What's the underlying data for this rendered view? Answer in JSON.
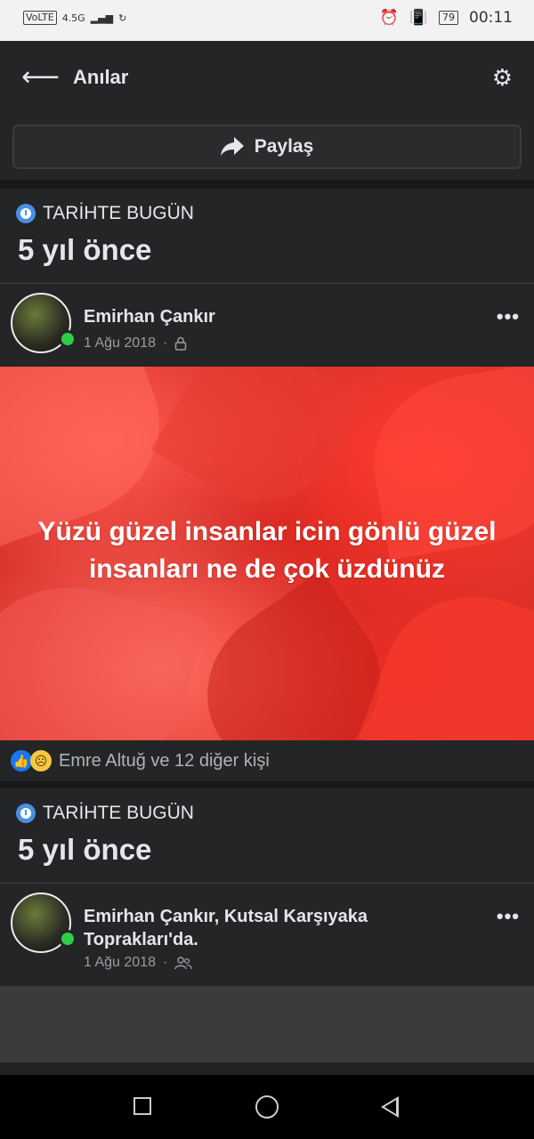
{
  "status": {
    "volte": "VoLTE",
    "network": "4.5G",
    "battery": "79",
    "time": "00:11"
  },
  "header": {
    "title": "Anılar",
    "share_label": "Paylaş"
  },
  "memories": [
    {
      "heading": "TARİHTE BUGÜN",
      "ago": "5 yıl önce",
      "author": "Emirhan Çankır",
      "date": "1 Ağu 2018",
      "privacy_icon": "lock-icon",
      "post_text": "Yüzü güzel insanlar icin gönlü güzel insanları ne de çok üzdünüz",
      "post_bg_color": "#d8322b",
      "reactions_text": "Emre Altuğ ve 12 diğer kişi"
    },
    {
      "heading": "TARİHTE BUGÜN",
      "ago": "5 yıl önce",
      "author_line": "Emirhan Çankır, Kutsal Karşıyaka Toprakları'da.",
      "date": "1 Ağu 2018",
      "privacy_icon": "friends-icon"
    }
  ]
}
